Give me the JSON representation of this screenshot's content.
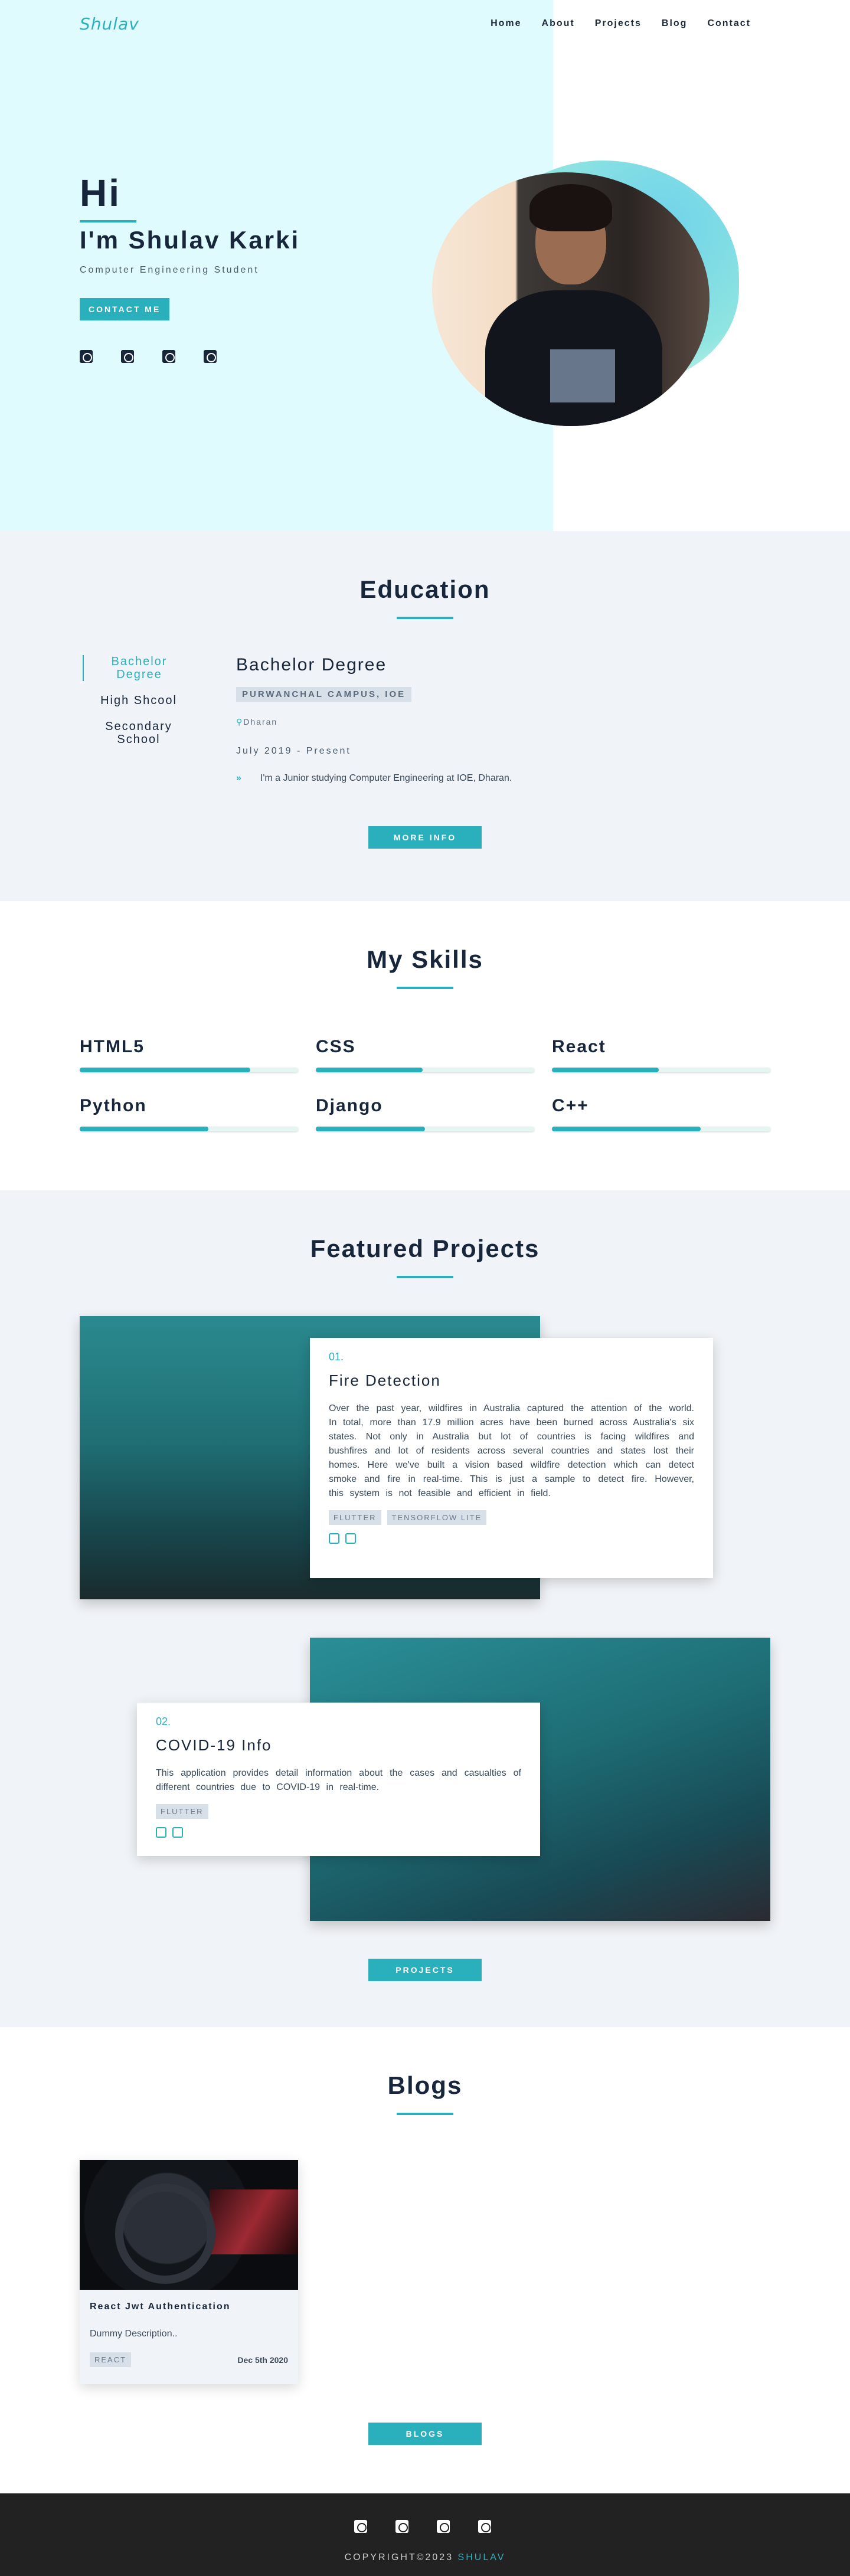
{
  "nav": {
    "logo": "Shulav",
    "links": [
      "Home",
      "About",
      "Projects",
      "Blog",
      "Contact"
    ]
  },
  "hero": {
    "greeting": "Hi",
    "name": "I'm Shulav Karki",
    "subtitle": "Computer Engineering Student",
    "cta": "CONTACT ME",
    "socials": [
      "twitter-icon",
      "github-icon",
      "reddit-icon",
      "instagram-icon"
    ]
  },
  "education": {
    "title": "Education",
    "tabs": [
      "Bachelor Degree",
      "High Shcool",
      "Secondary School"
    ],
    "active": {
      "degree": "Bachelor Degree",
      "campus": "PURWANCHAL CAMPUS, IOE",
      "location": "Dharan",
      "date": "July 2019 - Present",
      "description": "I'm a Junior studying Computer Engineering at IOE, Dharan."
    },
    "more": "MORE INFO"
  },
  "skills": {
    "title": "My Skills",
    "items": [
      {
        "name": "HTML5",
        "level": 0.78
      },
      {
        "name": "CSS",
        "level": 0.49
      },
      {
        "name": "React",
        "level": 0.49
      },
      {
        "name": "Python",
        "level": 0.59
      },
      {
        "name": "Django",
        "level": 0.5
      },
      {
        "name": "C++",
        "level": 0.68
      }
    ]
  },
  "projects": {
    "title": "Featured Projects",
    "items": [
      {
        "num": "01.",
        "title": "Fire Detection",
        "description": "Over the past year, wildfires in Australia captured the attention of the world. In total, more than 17.9 million acres have been burned across Australia's six states. Not only in Australia but lot of countries is facing wildfires and bushfires and lot of residents across several countries and states lost their homes. Here we've built a vision based wildfire detection which can detect smoke and fire in real-time. This is just a sample to detect fire. However, this system is not feasible and efficient in field.",
        "tags": [
          "FLUTTER",
          "TENSORFLOW LITE"
        ]
      },
      {
        "num": "02.",
        "title": "COVID-19 Info",
        "description": "This application provides detail information about the cases and casualties of different countries due to COVID-19 in real-time.",
        "tags": [
          "FLUTTER"
        ]
      }
    ],
    "button": "PROJECTS"
  },
  "blogs": {
    "title": "Blogs",
    "items": [
      {
        "title": "React Jwt Authentication",
        "description": "Dummy Description..",
        "tag": "REACT",
        "date": "Dec 5th 2020"
      }
    ],
    "button": "BLOGS"
  },
  "footer": {
    "copyright": "COPYRIGHT©2023",
    "brand": "SHULAV"
  }
}
